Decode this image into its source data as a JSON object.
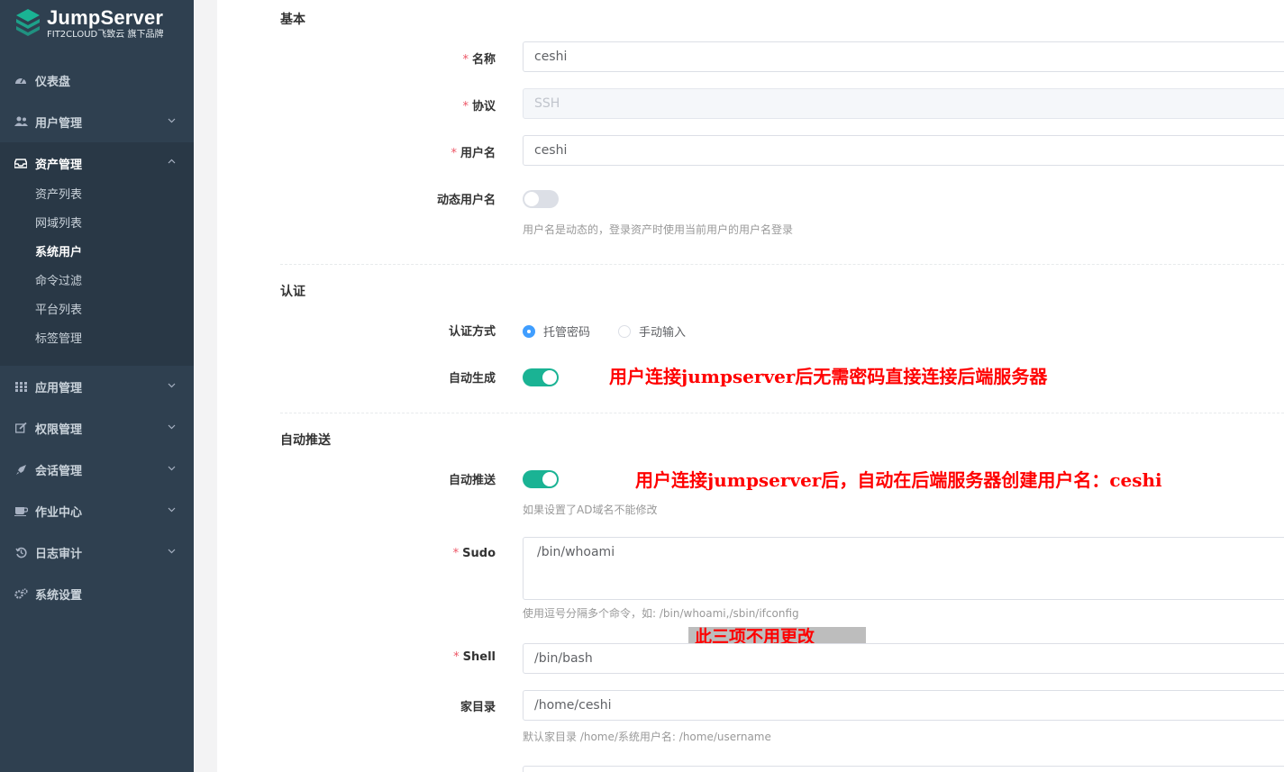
{
  "brand": {
    "title": "JumpServer",
    "subtitle": "FIT2CLOUD飞致云 旗下品牌",
    "accent": "#1ab394"
  },
  "sidebar": {
    "items": [
      {
        "label": "仪表盘",
        "icon": "dashboard-icon"
      },
      {
        "label": "用户管理",
        "icon": "users-icon"
      },
      {
        "label": "资产管理",
        "icon": "inbox-icon"
      },
      {
        "label": "应用管理",
        "icon": "grid-icon"
      },
      {
        "label": "权限管理",
        "icon": "edit-icon"
      },
      {
        "label": "会话管理",
        "icon": "rocket-icon"
      },
      {
        "label": "作业中心",
        "icon": "coffee-icon"
      },
      {
        "label": "日志审计",
        "icon": "history-icon"
      },
      {
        "label": "系统设置",
        "icon": "gears-icon"
      }
    ],
    "asset_sub": [
      "资产列表",
      "网域列表",
      "系统用户",
      "命令过滤",
      "平台列表",
      "标签管理"
    ],
    "active_sub": "系统用户"
  },
  "form": {
    "basic": {
      "title": "基本",
      "name_label": "名称",
      "name_value": "ceshi",
      "protocol_label": "协议",
      "protocol_value": "SSH",
      "username_label": "用户名",
      "username_value": "ceshi",
      "dynamic_label": "动态用户名",
      "dynamic_on": false,
      "dynamic_hint": "用户名是动态的，登录资产时使用当前用户的用户名登录"
    },
    "auth": {
      "title": "认证",
      "method_label": "认证方式",
      "method_options": [
        "托管密码",
        "手动输入"
      ],
      "method_selected": "托管密码",
      "autogen_label": "自动生成",
      "autogen_on": true
    },
    "push": {
      "title": "自动推送",
      "push_label": "自动推送",
      "push_on": true,
      "push_hint": "如果设置了AD域名不能修改",
      "sudo_label": "Sudo",
      "sudo_value": "/bin/whoami",
      "sudo_hint": "使用逗号分隔多个命令，如: /bin/whoami,/sbin/ifconfig",
      "shell_label": "Shell",
      "shell_value": "/bin/bash",
      "home_label": "家目录",
      "home_value": "/home/ceshi",
      "home_hint": "默认家目录 /home/系统用户名: /home/username"
    }
  },
  "annotations": {
    "autogen": "用户连接jumpserver后无需密码直接连接后端服务器",
    "push": "用户连接jumpserver后，自动在后端服务器创建用户名：ceshi",
    "no_change": "此三项不用更改"
  }
}
